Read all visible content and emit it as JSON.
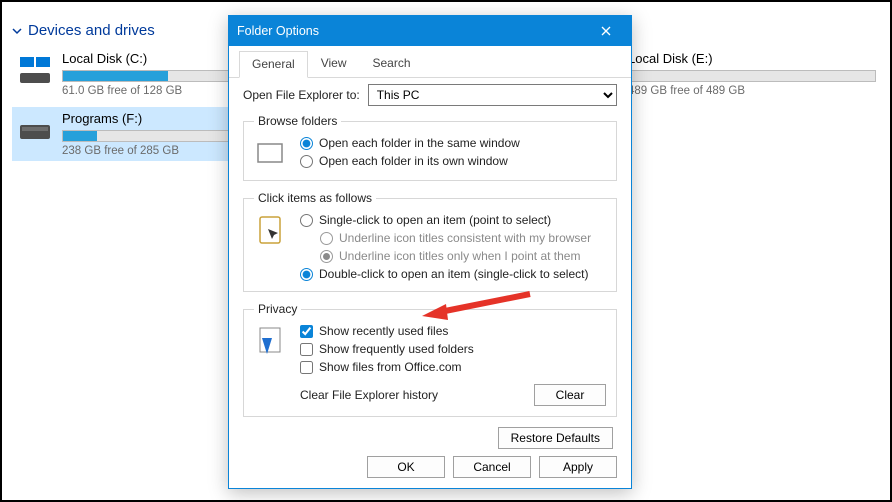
{
  "explorer": {
    "group_header": "Devices and drives",
    "drives": [
      {
        "name": "Local Disk (C:)",
        "free": "61.0 GB free of 128 GB",
        "fill_pct": 52,
        "selected": false
      },
      {
        "name": "Local Disk (E:)",
        "free": "489 GB free of 489 GB",
        "fill_pct": 1,
        "selected": false
      },
      {
        "name": "Programs (F:)",
        "free": "238 GB free of 285 GB",
        "fill_pct": 17,
        "selected": true
      }
    ]
  },
  "dialog": {
    "title": "Folder Options",
    "tabs": {
      "general": "General",
      "view": "View",
      "search": "Search"
    },
    "open_label": "Open File Explorer to:",
    "open_value": "This PC",
    "browse": {
      "legend": "Browse folders",
      "same_window": "Open each folder in the same window",
      "own_window": "Open each folder in its own window"
    },
    "click": {
      "legend": "Click items as follows",
      "single": "Single-click to open an item (point to select)",
      "underline_browser": "Underline icon titles consistent with my browser",
      "underline_point": "Underline icon titles only when I point at them",
      "double": "Double-click to open an item (single-click to select)"
    },
    "privacy": {
      "legend": "Privacy",
      "recent_files": "Show recently used files",
      "frequent_folders": "Show frequently used folders",
      "office": "Show files from Office.com",
      "clear_label": "Clear File Explorer history",
      "clear_btn": "Clear"
    },
    "restore": "Restore Defaults",
    "ok": "OK",
    "cancel": "Cancel",
    "apply": "Apply"
  }
}
